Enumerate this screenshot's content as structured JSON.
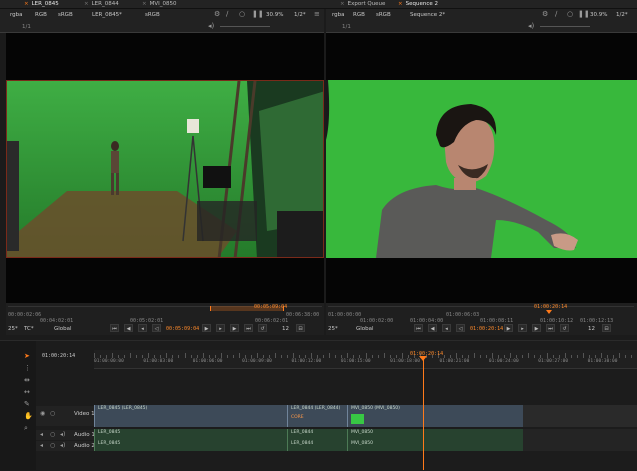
{
  "tabs": [
    {
      "label": "LER_0845",
      "active": true
    },
    {
      "label": "LER_0844",
      "active": false
    },
    {
      "label": "MVI_0850",
      "active": false
    },
    {
      "label": "Export Queue",
      "active": false
    },
    {
      "label": "Sequence 2",
      "active": true
    }
  ],
  "left_viewer": {
    "toolbar": {
      "channel": "rgba",
      "colorspace_1": "RGB",
      "colorspace_2": "sRGB",
      "clip_name": "LER_0845*",
      "gamma": "sRGB",
      "zoom": "30.9%",
      "fps": "1/2*",
      "frame_label": "1/1"
    },
    "timecode_start": "00:00:02:06",
    "timecode_in": "00:04:02:01",
    "timecode_mid": "00:05:02:01",
    "timecode_end": "00:06:02:01",
    "timecode_out": "00:06:38:00",
    "current_timecode": "00:05:09:04",
    "playhead_timecode": "00:05:09:04",
    "fps_display": "25*",
    "tc_mode": "TC*",
    "scope": "Global",
    "frame_step": "12"
  },
  "right_viewer": {
    "toolbar": {
      "channel": "rgba",
      "colorspace_1": "RGB",
      "colorspace_2": "sRGB",
      "clip_name": "Sequence 2*",
      "zoom": "30.9%",
      "fps": "1/2*",
      "frame_label": "1/1"
    },
    "timecode_start": "01:00:00:00",
    "timecode_marks": [
      "01:00:02:00",
      "01:00:04:00",
      "01:00:06:03",
      "01:00:08:11",
      "01:00:10:12",
      "01:00:12:13"
    ],
    "timecode_end": "01:00:24:00",
    "current_timecode": "01:00:20:14",
    "playhead_timecode": "01:00:20:14",
    "fps_display": "25*",
    "scope": "Global",
    "frame_step": "12"
  },
  "timeline": {
    "current_timecode": "01:00:20:14",
    "playhead_label": "01:00:20:14",
    "ruler_labels": [
      "01:00:00:00",
      "01:00:03:00",
      "01:00:06:00",
      "01:00:09:00",
      "01:00:12:00",
      "01:00:15:00",
      "01:00:18:00",
      "01:00:21:00",
      "01:00:24:00",
      "01:00:27:00",
      "01:00:30:00"
    ],
    "tracks": [
      {
        "name": "Video 1",
        "clips": [
          "LER_0845 (LER_0845)",
          "LER_0844 (LER_0844)",
          "MVI_0850 (MVI_0850)"
        ],
        "sublabel": "CORE"
      },
      {
        "name": "Audio 1",
        "clips": [
          "LER_0845",
          "LER_0844",
          "MVI_0850"
        ]
      },
      {
        "name": "Audio 2",
        "clips": [
          "LER_0845",
          "LER_0844",
          "MVI_0850"
        ]
      }
    ]
  },
  "colors": {
    "accent": "#ff7a1a",
    "panel": "#1b1b1b",
    "greenscreen": "#2f9e3a",
    "video_clip": "#3d4a58",
    "audio_clip": "#27422f"
  }
}
